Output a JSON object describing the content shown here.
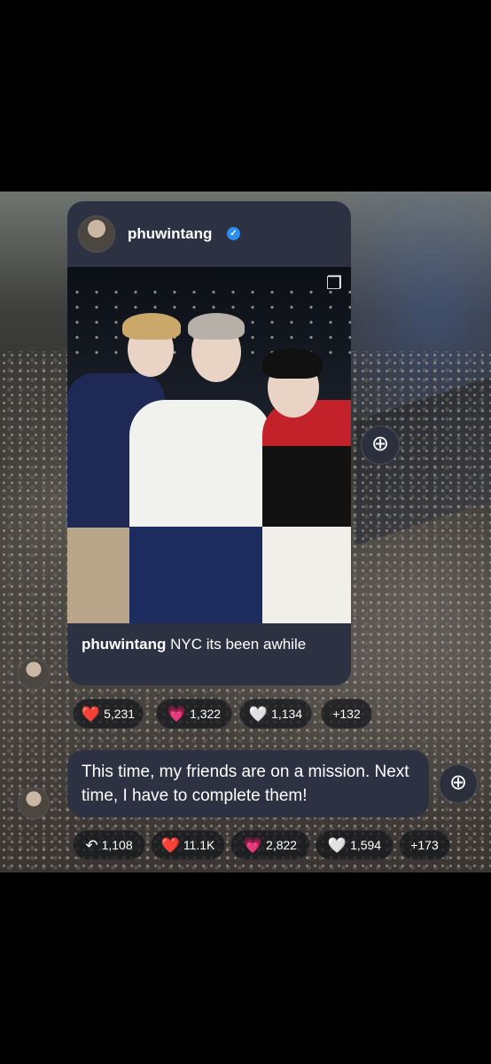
{
  "post": {
    "username": "phuwintang",
    "caption_user": "phuwintang",
    "caption_text": "NYC its been awhile"
  },
  "reactions_post": [
    {
      "icon": "red-heart-icon",
      "emoji": "❤️",
      "count": "5,231"
    },
    {
      "icon": "pink-heart-icon",
      "emoji": "💗",
      "count": "1,322"
    },
    {
      "icon": "white-heart-icon",
      "emoji": "🤍",
      "count": "1,134"
    },
    {
      "icon": "",
      "emoji": "",
      "count": "+132"
    }
  ],
  "message": {
    "text": "This time, my friends are on a mission. Next time, I have to complete them!"
  },
  "reactions_message": [
    {
      "icon": "reply-icon",
      "emoji": "↶",
      "count": "1,108"
    },
    {
      "icon": "red-heart-icon",
      "emoji": "❤️",
      "count": "11.1K"
    },
    {
      "icon": "pink-heart-icon",
      "emoji": "💗",
      "count": "2,822"
    },
    {
      "icon": "white-heart-icon",
      "emoji": "🤍",
      "count": "1,594"
    },
    {
      "icon": "",
      "emoji": "",
      "count": "+173"
    }
  ],
  "colors": {
    "bubble": "#2c3242",
    "verified": "#2d8cf0"
  }
}
